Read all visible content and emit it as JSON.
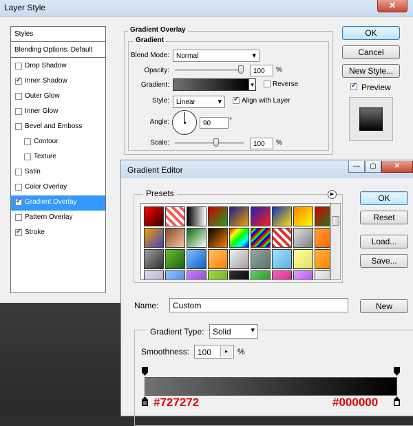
{
  "layer_style": {
    "title": "Layer Style",
    "styles_header": "Styles",
    "blending_options": "Blending Options: Default",
    "items": [
      {
        "label": "Drop Shadow",
        "checked": false,
        "sub": false,
        "selected": false
      },
      {
        "label": "Inner Shadow",
        "checked": true,
        "sub": false,
        "selected": false
      },
      {
        "label": "Outer Glow",
        "checked": false,
        "sub": false,
        "selected": false
      },
      {
        "label": "Inner Glow",
        "checked": false,
        "sub": false,
        "selected": false
      },
      {
        "label": "Bevel and Emboss",
        "checked": false,
        "sub": false,
        "selected": false
      },
      {
        "label": "Contour",
        "checked": false,
        "sub": true,
        "selected": false
      },
      {
        "label": "Texture",
        "checked": false,
        "sub": true,
        "selected": false
      },
      {
        "label": "Satin",
        "checked": false,
        "sub": false,
        "selected": false
      },
      {
        "label": "Color Overlay",
        "checked": false,
        "sub": false,
        "selected": false
      },
      {
        "label": "Gradient Overlay",
        "checked": true,
        "sub": false,
        "selected": true
      },
      {
        "label": "Pattern Overlay",
        "checked": false,
        "sub": false,
        "selected": false
      },
      {
        "label": "Stroke",
        "checked": true,
        "sub": false,
        "selected": false
      }
    ],
    "panel": {
      "section_title": "Gradient Overlay",
      "group_title": "Gradient",
      "blend_mode_label": "Blend Mode:",
      "blend_mode_value": "Normal",
      "opacity_label": "Opacity:",
      "opacity_value": "100",
      "opacity_unit": "%",
      "opacity_level": 1.0,
      "gradient_label": "Gradient:",
      "reverse_label": "Reverse",
      "reverse_checked": false,
      "style_label": "Style:",
      "style_value": "Linear",
      "align_label": "Align with Layer",
      "align_checked": true,
      "angle_label": "Angle:",
      "angle_value": "90",
      "angle_unit": "°",
      "scale_label": "Scale:",
      "scale_value": "100",
      "scale_unit": "%",
      "scale_level": 0.5
    },
    "buttons": {
      "ok": "OK",
      "cancel": "Cancel",
      "new_style": "New Style...",
      "preview": "Preview",
      "preview_checked": true
    }
  },
  "gradient_editor": {
    "title": "Gradient Editor",
    "presets_label": "Presets",
    "buttons": {
      "ok": "OK",
      "reset": "Reset",
      "load": "Load...",
      "save": "Save..."
    },
    "name_label": "Name:",
    "name_value": "Custom",
    "new_button": "New",
    "gradient_type_label": "Gradient Type:",
    "gradient_type_value": "Solid",
    "smoothness_label": "Smoothness:",
    "smoothness_value": "100",
    "smoothness_unit": "%",
    "stop_left_label": "#727272",
    "stop_right_label": "#000000",
    "colors": {
      "start": "#727272",
      "end": "#000000",
      "annotation": "#e00000"
    },
    "presets": [
      "linear-gradient(135deg,#ff0000,#300000)",
      "repeating-linear-gradient(45deg,#ff5555 0 4px,#ffffff 4px 8px)",
      "linear-gradient(90deg,#000,#fff)",
      "linear-gradient(135deg,#d00000,#20a020)",
      "linear-gradient(135deg,#1e1e8e,#f0a000)",
      "linear-gradient(135deg,#2020b0,#ff2020)",
      "linear-gradient(135deg,#1030c0,#ffe000)",
      "linear-gradient(135deg,#ff8000,#ffff00)",
      "linear-gradient(135deg,#d00000,#208020)",
      "linear-gradient(135deg,#f0a000,#4040c0)",
      "linear-gradient(135deg,#8b4a2a,#f5c8a0)",
      "linear-gradient(135deg,#0b6b0b,#ffffff)",
      "linear-gradient(135deg,#000000,#ff8000)",
      "linear-gradient(135deg,#ff0000,#ffff00,#00ff00,#00ffff,#0000ff)",
      "repeating-linear-gradient(135deg,#ff0000 0 3px,#00ff00 3px 6px,#0000ff 6px 9px)",
      "repeating-linear-gradient(45deg,#e03030 0 4px,#ffffff 4px 8px)",
      "linear-gradient(135deg,#e0e0e0,#808080)",
      "linear-gradient(135deg,#ffa030,#ff6000)",
      "linear-gradient(135deg,#a0a0a0,#303030)",
      "linear-gradient(135deg,#60c030,#206010)",
      "linear-gradient(135deg,#80c0ff,#1060c0)",
      "linear-gradient(135deg,#ffc070,#ff8000)",
      "linear-gradient(135deg,#f0f0f0,#a0a0a0)",
      "linear-gradient(135deg,#90a8a0,#607068)",
      "linear-gradient(135deg,#a0e0ff,#60b0e0)",
      "linear-gradient(135deg,#ffffa0,#e0e060)",
      "linear-gradient(135deg,#ffb040,#ff8000)",
      "linear-gradient(135deg,#e0e0f0,#a0a0c0)",
      "linear-gradient(135deg,#90c0ff,#4080e0)",
      "linear-gradient(135deg,#c080ff,#8040c0)",
      "linear-gradient(135deg,#a0e040,#60a010)",
      "linear-gradient(135deg,#303030,#000000)",
      "linear-gradient(135deg,#60d060,#208020)",
      "linear-gradient(135deg,#ff60c0,#c02080)",
      "linear-gradient(135deg,#e0a0ff,#a040e0)",
      "linear-gradient(135deg,#f0f0f0,#c0c0c0)"
    ]
  }
}
